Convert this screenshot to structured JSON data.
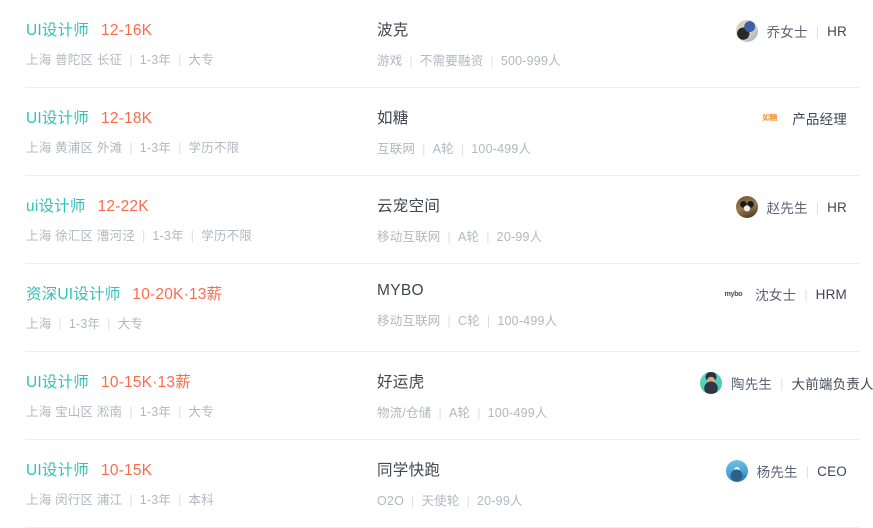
{
  "colors": {
    "title_teal": "#30c2b7",
    "salary_orange": "#fb6c4c",
    "company_name": "#41464f",
    "meta_gray": "#b4b7c1",
    "divider": "#eeeef1",
    "role_dark": "#3f4655"
  },
  "separator": "|",
  "jobs": [
    {
      "title": "UI设计师",
      "salary": "12-16K",
      "city": "上海",
      "district": "普陀区",
      "area": "长征",
      "experience": "1-3年",
      "education": "大专",
      "company": "波克",
      "industry": "游戏",
      "funding": "不需要融资",
      "size": "500-999人",
      "recruiter_name": "乔女士",
      "recruiter_role": "HR",
      "avatar_kind": "photo",
      "avatar_class": "av-qiao",
      "avatar_icon": "user-avatar-photo"
    },
    {
      "title": "UI设计师",
      "salary": "12-18K",
      "city": "上海",
      "district": "黄浦区",
      "area": "外滩",
      "experience": "1-3年",
      "education": "学历不限",
      "company": "如糖",
      "industry": "互联网",
      "funding": "A轮",
      "size": "100-499人",
      "recruiter_name": "",
      "recruiter_role": "产品经理",
      "avatar_kind": "logo",
      "avatar_text": "如糖",
      "avatar_class": "",
      "avatar_icon": "company-logo-rutang"
    },
    {
      "title": "ui设计师",
      "salary": "12-22K",
      "city": "上海",
      "district": "徐汇区",
      "area": "漕河泾",
      "experience": "1-3年",
      "education": "学历不限",
      "company": "云宠空间",
      "industry": "移动互联网",
      "funding": "A轮",
      "size": "20-99人",
      "recruiter_name": "赵先生",
      "recruiter_role": "HR",
      "avatar_kind": "photo",
      "avatar_class": "av-zhao",
      "avatar_icon": "user-avatar-photo"
    },
    {
      "title": "资深UI设计师",
      "salary": "10-20K·13薪",
      "city": "上海",
      "district": "",
      "area": "",
      "experience": "1-3年",
      "education": "大专",
      "company": "MYBO",
      "industry": "移动互联网",
      "funding": "C轮",
      "size": "100-499人",
      "recruiter_name": "沈女士",
      "recruiter_role": "HRM",
      "avatar_kind": "logo",
      "avatar_text": "mybo",
      "avatar_class": "mybo",
      "avatar_icon": "company-logo-mybo"
    },
    {
      "title": "UI设计师",
      "salary": "10-15K·13薪",
      "city": "上海",
      "district": "宝山区",
      "area": "淞南",
      "experience": "1-3年",
      "education": "大专",
      "company": "好运虎",
      "industry": "物流/仓储",
      "funding": "A轮",
      "size": "100-499人",
      "recruiter_name": "陶先生",
      "recruiter_role": "大前端负责人",
      "avatar_kind": "photo",
      "avatar_class": "av-tao",
      "avatar_icon": "user-avatar-photo"
    },
    {
      "title": "UI设计师",
      "salary": "10-15K",
      "city": "上海",
      "district": "闵行区",
      "area": "浦江",
      "experience": "1-3年",
      "education": "本科",
      "company": "同学快跑",
      "industry": "O2O",
      "funding": "天使轮",
      "size": "20-99人",
      "recruiter_name": "杨先生",
      "recruiter_role": "CEO",
      "avatar_kind": "photo",
      "avatar_class": "av-yang",
      "avatar_icon": "user-avatar-photo"
    }
  ]
}
